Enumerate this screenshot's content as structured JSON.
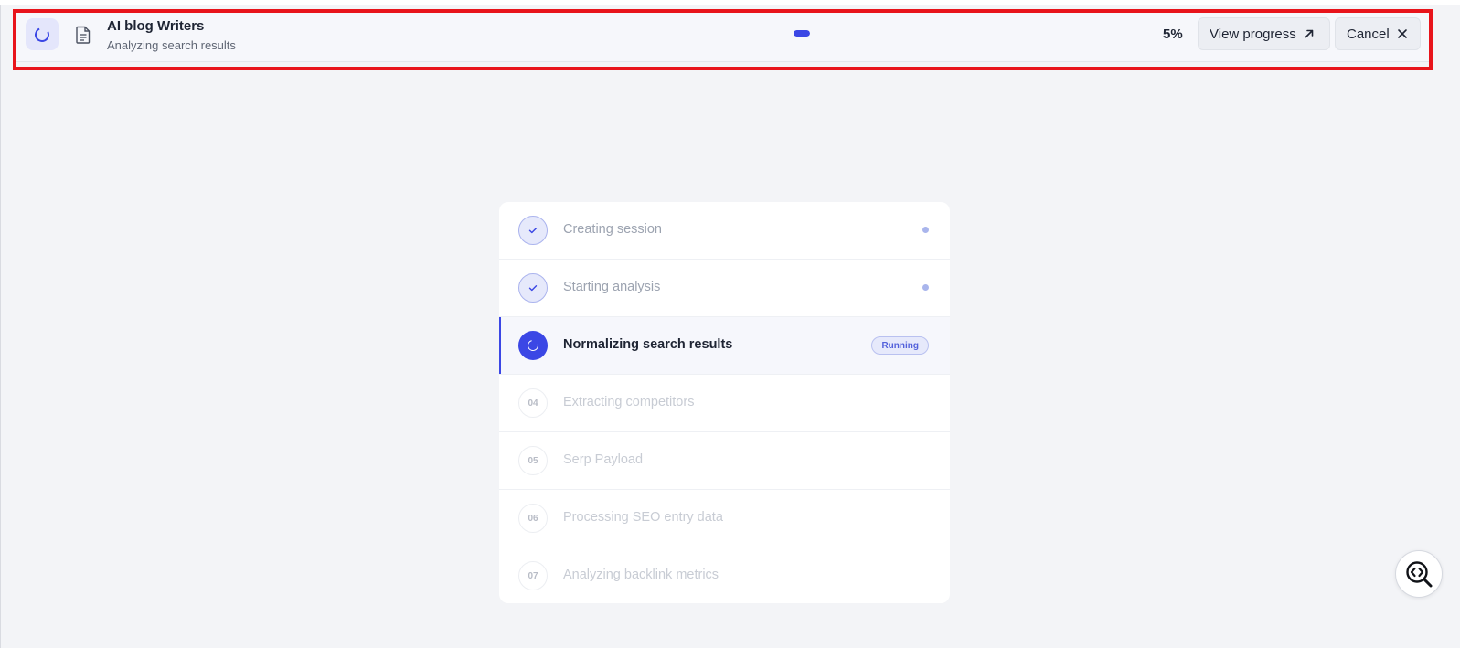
{
  "banner": {
    "title": "AI blog Writers",
    "subtitle": "Analyzing search results",
    "progress_percent": 5,
    "percent_label": "5%",
    "view_progress_label": "View progress",
    "cancel_label": "Cancel",
    "accent_color": "#3b47e5",
    "icons": [
      "spinner-icon",
      "document-icon",
      "arrow-up-right-icon",
      "close-icon"
    ]
  },
  "steps": [
    {
      "label": "Creating session",
      "status": "done",
      "marker": ""
    },
    {
      "label": "Starting analysis",
      "status": "done",
      "marker": ""
    },
    {
      "label": "Normalizing search results",
      "status": "active",
      "marker": "",
      "badge": "Running"
    },
    {
      "label": "Extracting competitors",
      "status": "pending",
      "marker": "04"
    },
    {
      "label": "Serp Payload",
      "status": "pending",
      "marker": "05"
    },
    {
      "label": "Processing SEO entry data",
      "status": "pending",
      "marker": "06"
    },
    {
      "label": "Analyzing backlink metrics",
      "status": "pending",
      "marker": "07"
    }
  ],
  "widget": {
    "icon": "code-search-icon"
  },
  "highlight_color": "#e8141b"
}
